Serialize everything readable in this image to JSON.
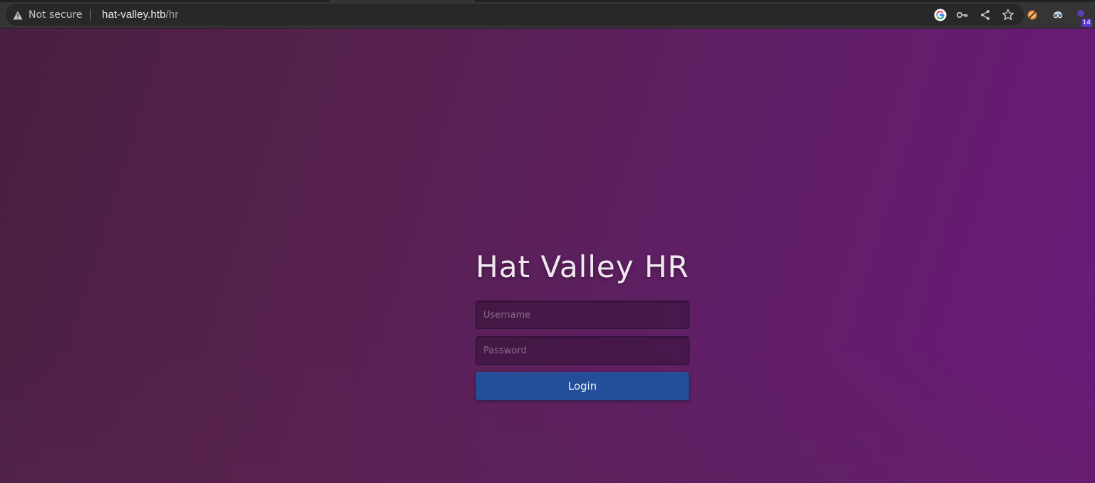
{
  "browser": {
    "security_label": "Not secure",
    "url_host": "hat-valley.htb",
    "url_path": "/hr",
    "extension_badge": "14",
    "colors": {
      "toolbar_bg": "#353535",
      "omnibox_bg": "#282828"
    },
    "icons": [
      "warning-icon",
      "google-icon",
      "key-icon",
      "share-icon",
      "star-icon",
      "extension-cookie-icon",
      "extension-spy-icon",
      "extension-badge-icon"
    ]
  },
  "page": {
    "title": "Hat Valley HR",
    "username_placeholder": "Username",
    "password_placeholder": "Password",
    "login_label": "Login",
    "colors": {
      "background_start": "#4a1f40",
      "background_end": "#6a1a7a",
      "button": "#234e9a"
    }
  }
}
